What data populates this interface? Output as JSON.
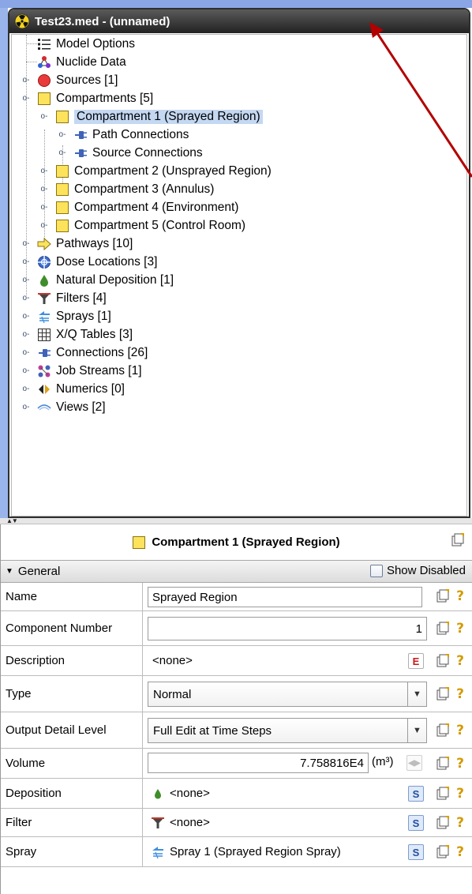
{
  "window": {
    "title": "Test23.med - (unnamed)"
  },
  "tree": {
    "items": [
      {
        "label": "Model Options",
        "icon": "model-options-icon"
      },
      {
        "label": "Nuclide Data",
        "icon": "nuclide-data-icon"
      },
      {
        "label": "Sources [1]",
        "icon": "source-red-circle-icon"
      },
      {
        "label": "Compartments [5]",
        "icon": "compartment-yellow-box-icon"
      },
      {
        "label": "Compartment 1 (Sprayed Region)",
        "icon": "compartment-yellow-box-icon",
        "selected": true
      },
      {
        "label": "Path Connections",
        "icon": "connection-plug-icon"
      },
      {
        "label": "Source Connections",
        "icon": "connection-plug-icon"
      },
      {
        "label": "Compartment 2 (Unsprayed Region)",
        "icon": "compartment-yellow-box-icon"
      },
      {
        "label": "Compartment 3 (Annulus)",
        "icon": "compartment-yellow-box-icon"
      },
      {
        "label": "Compartment 4 (Environment)",
        "icon": "compartment-yellow-box-icon"
      },
      {
        "label": "Compartment 5 (Control Room)",
        "icon": "compartment-yellow-box-icon"
      },
      {
        "label": "Pathways [10]",
        "icon": "pathway-arrow-icon"
      },
      {
        "label": "Dose Locations [3]",
        "icon": "dose-location-crosshair-icon"
      },
      {
        "label": "Natural Deposition [1]",
        "icon": "deposition-drop-icon"
      },
      {
        "label": "Filters [4]",
        "icon": "filter-funnel-icon"
      },
      {
        "label": "Sprays [1]",
        "icon": "spray-icon"
      },
      {
        "label": "X/Q Tables [3]",
        "icon": "table-grid-icon"
      },
      {
        "label": "Connections [26]",
        "icon": "connection-plug-icon"
      },
      {
        "label": "Job Streams [1]",
        "icon": "job-stream-icon"
      },
      {
        "label": "Numerics [0]",
        "icon": "numerics-icon"
      },
      {
        "label": "Views [2]",
        "icon": "views-eye-icon"
      }
    ]
  },
  "properties": {
    "header": "Compartment 1 (Sprayed Region)",
    "section": "General",
    "show_disabled": "Show Disabled",
    "rows": {
      "name": {
        "label": "Name",
        "value": "Sprayed Region"
      },
      "component_number": {
        "label": "Component Number",
        "value": "1"
      },
      "description": {
        "label": "Description",
        "value": "<none>"
      },
      "type": {
        "label": "Type",
        "value": "Normal"
      },
      "output_detail": {
        "label": "Output Detail Level",
        "value": "Full Edit at Time Steps"
      },
      "volume": {
        "label": "Volume",
        "value": "7.758816E4",
        "unit": "(m³)"
      },
      "deposition": {
        "label": "Deposition",
        "value": "<none>"
      },
      "filter": {
        "label": "Filter",
        "value": "<none>"
      },
      "spray": {
        "label": "Spray",
        "value": "Spray 1 (Sprayed Region Spray)"
      }
    },
    "button_e": "E",
    "button_s": "S",
    "help": "?"
  },
  "colors": {
    "accent": "#c4d8f2",
    "title_bar": "#2b2b2b",
    "annotation_arrow": "#b30000"
  }
}
